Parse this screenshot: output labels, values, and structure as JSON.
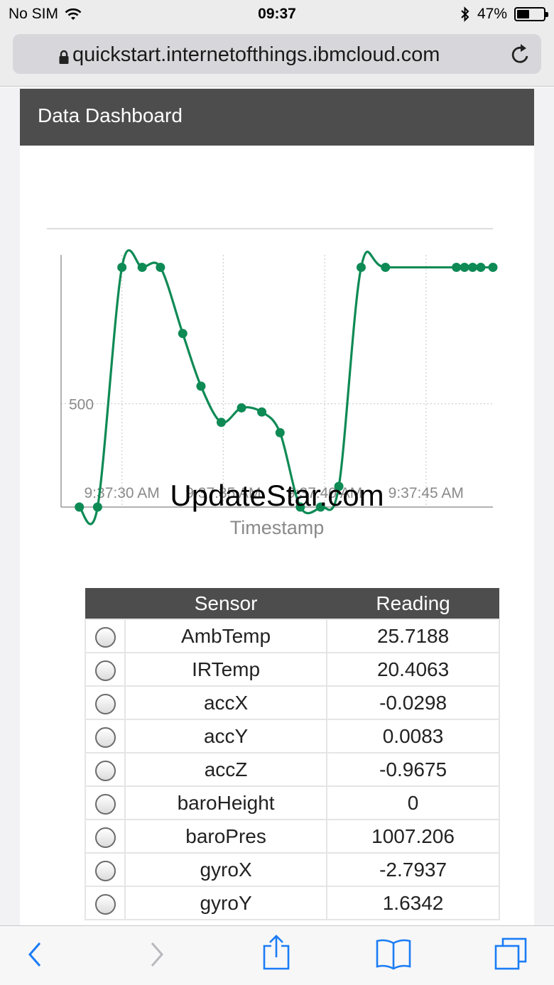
{
  "status_bar": {
    "carrier": "No SIM",
    "time": "09:37",
    "battery": "47%",
    "battery_level": 0.47
  },
  "browser": {
    "url": "quickstart.internetofthings.ibmcloud.com"
  },
  "dashboard": {
    "title": "Data Dashboard"
  },
  "chart_data": {
    "type": "line",
    "xlabel": "Timestamp",
    "x_ticks": [
      "9:37:30 AM",
      "9:37:35 AM",
      "9:37:40 AM",
      "9:37:45 AM"
    ],
    "y_ticks": [
      500
    ],
    "ylim": [
      0,
      1220
    ],
    "grid": true,
    "color": "#0e8a55",
    "series": [
      {
        "x": [
          27.9,
          28.8,
          30.0,
          31.0,
          31.9,
          33.0,
          33.9,
          34.9,
          35.9,
          36.9,
          37.8,
          38.8,
          39.8,
          40.7,
          41.8,
          43.0,
          46.5,
          46.9,
          47.3,
          47.7,
          48.3
        ],
        "values": [
          0,
          0,
          1160,
          1160,
          1160,
          840,
          585,
          410,
          480,
          460,
          360,
          0,
          0,
          100,
          1160,
          1160,
          1160,
          1160,
          1160,
          1160,
          1160
        ]
      }
    ],
    "watermark": "UpdateStar.com"
  },
  "table": {
    "headers": [
      "Sensor",
      "Reading"
    ],
    "rows": [
      {
        "sensor": "AmbTemp",
        "reading": "25.7188"
      },
      {
        "sensor": "IRTemp",
        "reading": "20.4063"
      },
      {
        "sensor": "accX",
        "reading": "-0.0298"
      },
      {
        "sensor": "accY",
        "reading": "0.0083"
      },
      {
        "sensor": "accZ",
        "reading": "-0.9675"
      },
      {
        "sensor": "baroHeight",
        "reading": "0"
      },
      {
        "sensor": "baroPres",
        "reading": "1007.206"
      },
      {
        "sensor": "gyroX",
        "reading": "-2.7937"
      },
      {
        "sensor": "gyroY",
        "reading": "1.6342"
      }
    ]
  },
  "toolbar": {
    "icons": [
      "back-icon",
      "forward-icon",
      "share-icon",
      "bookmarks-icon",
      "tabs-icon"
    ]
  }
}
